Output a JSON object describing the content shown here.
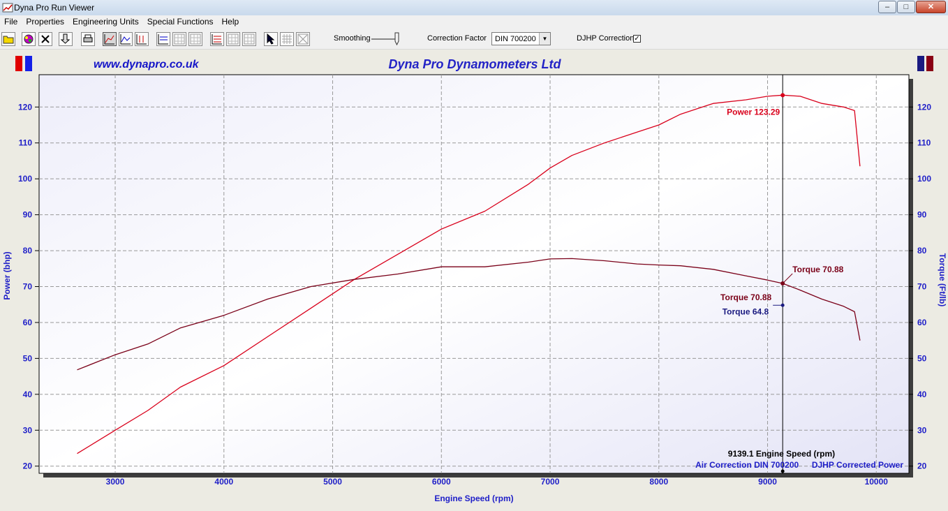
{
  "window": {
    "title": "Dyna Pro Run Viewer",
    "minimize": "–",
    "maximize": "□",
    "close": "✕"
  },
  "menu": [
    "File",
    "Properties",
    "Engineering Units",
    "Special Functions",
    "Help"
  ],
  "toolbar": {
    "smoothing_label": "Smoothing",
    "correction_label": "Correction Factor",
    "correction_value": "DIN 700200",
    "djhp_label": "DJHP Correction",
    "djhp_checked": "✓"
  },
  "colors": {
    "power": "#d9001b",
    "torque": "#7a0018",
    "torque_alt": "#1a1a80",
    "label_blue": "#2020c8",
    "title": "#2323c6"
  },
  "chart_data": {
    "type": "line",
    "title": "Dyna Pro Dynamometers Ltd",
    "website": "www.dynapro.co.uk",
    "xlabel": "Engine Speed (rpm)",
    "ylabel_left": "Power (bhp)",
    "ylabel_right": "Torque (Ft/lb)",
    "xlim": [
      2300,
      10300
    ],
    "ylim": [
      18,
      129
    ],
    "xticks": [
      3000,
      4000,
      5000,
      6000,
      7000,
      8000,
      9000,
      10000
    ],
    "yticks": [
      20,
      30,
      40,
      50,
      60,
      70,
      80,
      90,
      100,
      110,
      120
    ],
    "grid": true,
    "series": [
      {
        "name": "Power",
        "axis": "left",
        "color": "#d9001b",
        "x": [
          2650,
          3000,
          3300,
          3600,
          4000,
          4400,
          4800,
          5200,
          5600,
          6000,
          6400,
          6800,
          7000,
          7200,
          7500,
          7800,
          8000,
          8200,
          8500,
          8800,
          9000,
          9139,
          9300,
          9500,
          9700,
          9800,
          9850
        ],
        "y": [
          23.5,
          30,
          35.5,
          42,
          48,
          56,
          64,
          72,
          79,
          86,
          91,
          98.5,
          103,
          106.5,
          110,
          113,
          115,
          118,
          121,
          122,
          123,
          123.3,
          123,
          121,
          120,
          119,
          103.5
        ]
      },
      {
        "name": "Torque",
        "axis": "right",
        "color": "#7a0018",
        "x": [
          2650,
          3000,
          3300,
          3600,
          4000,
          4400,
          4800,
          5200,
          5600,
          6000,
          6400,
          6800,
          7000,
          7200,
          7500,
          7800,
          8000,
          8200,
          8500,
          8800,
          9000,
          9139,
          9300,
          9500,
          9700,
          9800,
          9850
        ],
        "y": [
          46.8,
          51,
          54,
          58.5,
          62,
          66.5,
          70,
          72,
          73.5,
          75.5,
          75.5,
          76.8,
          77.7,
          77.8,
          77.2,
          76.3,
          76,
          75.8,
          74.8,
          73,
          71.8,
          70.88,
          69,
          66.5,
          64.5,
          63,
          55
        ]
      }
    ],
    "cursor": {
      "x": 9139.1,
      "label": "9139.1 Engine Speed (rpm)"
    },
    "annotations": [
      {
        "text": "Power 123.29",
        "value": 123.29,
        "color": "#d9001b"
      },
      {
        "text": "Torque 70.88",
        "value": 70.88,
        "color": "#7a0018"
      },
      {
        "text": "Torque 70.88",
        "value": 70.88,
        "color": "#7a0018"
      },
      {
        "text": "Torque 64.8",
        "value": 64.8,
        "color": "#1a1a80"
      }
    ],
    "footer_left": "Air Correction DIN 700200",
    "footer_right": "DJHP Corrected Power"
  }
}
